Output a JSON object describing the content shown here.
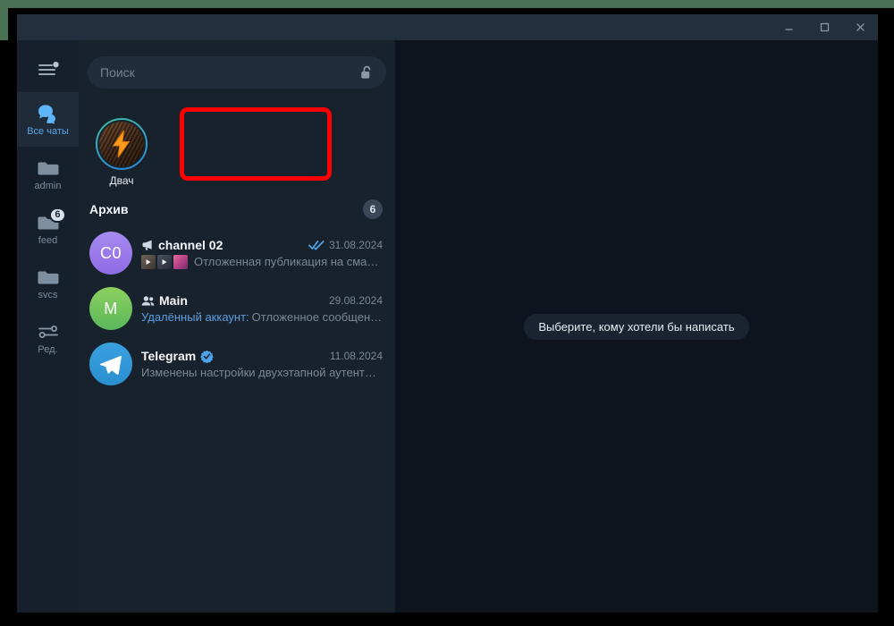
{
  "window": {
    "controls": [
      {
        "name": "minimize-button",
        "glyph": "minimize"
      },
      {
        "name": "maximize-button",
        "glyph": "maximize"
      },
      {
        "name": "close-button",
        "glyph": "close"
      }
    ]
  },
  "rail": {
    "menu_icon": "hamburger-menu-icon",
    "items": [
      {
        "label": "Все чаты",
        "icon": "chats-bubbles-icon",
        "active": true,
        "badge": ""
      },
      {
        "label": "admin",
        "icon": "folder-icon",
        "active": false,
        "badge": ""
      },
      {
        "label": "feed",
        "icon": "folder-icon",
        "active": false,
        "badge": "6"
      },
      {
        "label": "svcs",
        "icon": "folder-icon",
        "active": false,
        "badge": ""
      },
      {
        "label": "Ред.",
        "icon": "sliders-edit-icon",
        "active": false,
        "badge": ""
      }
    ]
  },
  "search": {
    "placeholder": "Поиск",
    "lock_icon": "unlocked-padlock-icon"
  },
  "stories": [
    {
      "name": "Двач",
      "avatar_icon": "lightning-bolt-icon",
      "highlighted": true
    }
  ],
  "archive": {
    "label": "Архив",
    "badge": "6"
  },
  "chats": [
    {
      "avatar_text": "C0",
      "avatar_style": "av-purple",
      "title": "channel 02",
      "title_icon": "megaphone-icon",
      "date": "31.08.2024",
      "read_status_icon": "double-check-icon",
      "sender": "",
      "preview": "Отложенная публикация на смар…",
      "thumbnails": [
        "video-thumbnail",
        "video-thumbnail",
        "photo-thumbnail"
      ]
    },
    {
      "avatar_text": "M",
      "avatar_style": "av-green",
      "title": "Main",
      "title_icon": "group-people-icon",
      "date": "29.08.2024",
      "read_status_icon": "",
      "sender": "Удалённый аккаунт:",
      "preview": "Отложенное сообщен…",
      "thumbnails": []
    },
    {
      "avatar_text": "",
      "avatar_style": "av-tg",
      "title": "Telegram",
      "title_icon": "verified-badge-icon",
      "date": "11.08.2024",
      "read_status_icon": "",
      "sender": "",
      "preview": "Изменены настройки двухэтапной аутент…",
      "thumbnails": []
    }
  ],
  "right_pane": {
    "empty_state": "Выберите, кому хотели бы написать"
  },
  "colors": {
    "accent": "#4ea4e6",
    "highlight_box": "#fe0000",
    "panel_list": "#18222d",
    "panel_rail": "#16202d",
    "panel_right": "#0e141e",
    "titlebar": "#242f3d"
  }
}
